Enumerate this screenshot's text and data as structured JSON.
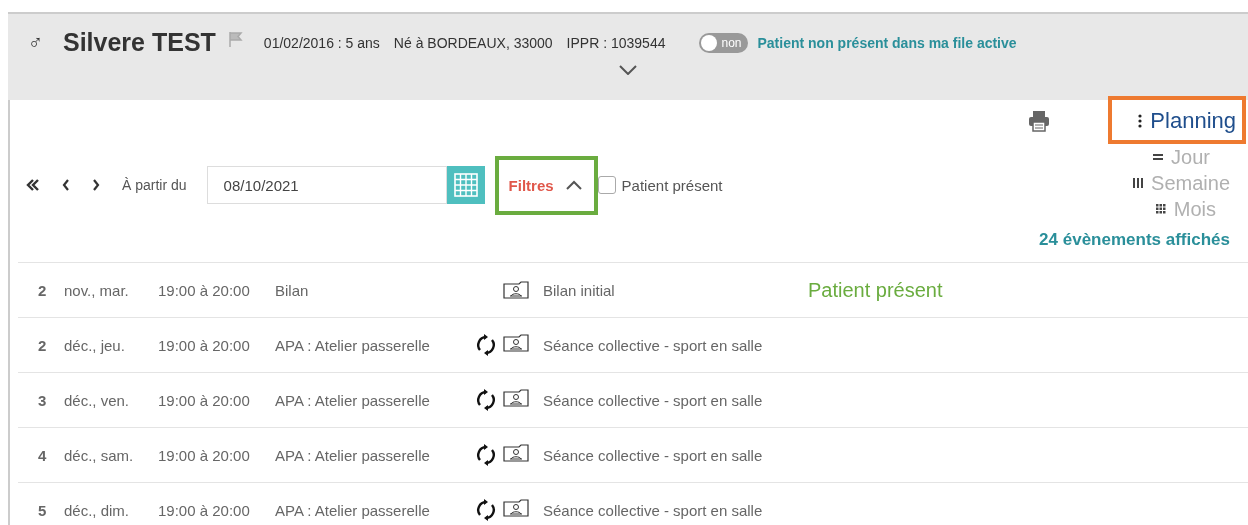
{
  "patient": {
    "sex_symbol": "♂",
    "name": "Silvere TEST",
    "birth": "01/02/2016 : 5 ans",
    "birthplace": "Né à BORDEAUX, 33000",
    "ippr": "IPPR : 1039544",
    "active_toggle": {
      "on": false,
      "label": "non"
    },
    "active_status": "Patient non présent dans ma file active"
  },
  "toolbar": {
    "start_label": "À partir du",
    "date": "08/10/2021",
    "filters_label": "Filtres",
    "filters_expanded": true,
    "present_checkbox": {
      "label": "Patient présent",
      "checked": false
    }
  },
  "view_menu": {
    "title": "Planning",
    "options": [
      {
        "label": "Jour",
        "selected": false
      },
      {
        "label": "Semaine",
        "selected": false
      },
      {
        "label": "Mois",
        "selected": false
      }
    ]
  },
  "event_count": "24 évènements affichés",
  "events": [
    {
      "day": "2",
      "month_weekday": "nov., mar.",
      "time": "19:00 à 20:00",
      "type": "Bilan",
      "recurring": false,
      "title": "Bilan initial"
    },
    {
      "day": "2",
      "month_weekday": "déc., jeu.",
      "time": "19:00 à 20:00",
      "type": "APA : Atelier passerelle",
      "recurring": true,
      "title": "Séance collective - sport en salle"
    },
    {
      "day": "3",
      "month_weekday": "déc., ven.",
      "time": "19:00 à 20:00",
      "type": "APA : Atelier passerelle",
      "recurring": true,
      "title": "Séance collective - sport en salle"
    },
    {
      "day": "4",
      "month_weekday": "déc., sam.",
      "time": "19:00 à 20:00",
      "type": "APA : Atelier passerelle",
      "recurring": true,
      "title": "Séance collective - sport en salle"
    },
    {
      "day": "5",
      "month_weekday": "déc., dim.",
      "time": "19:00 à 20:00",
      "type": "APA : Atelier passerelle",
      "recurring": true,
      "title": "Séance collective - sport en salle"
    }
  ],
  "annotation_note": "Patient présent"
}
